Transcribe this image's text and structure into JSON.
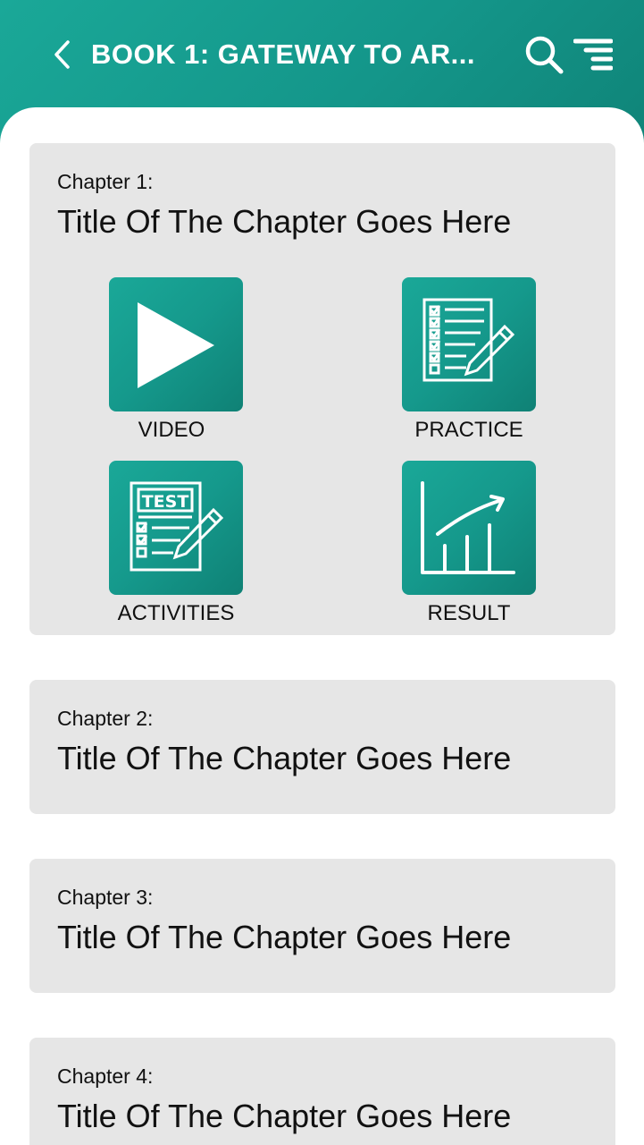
{
  "header": {
    "title": "BOOK 1: GATEWAY TO AR...",
    "back_icon": "chevron-left-icon",
    "search_icon": "search-icon",
    "menu_icon": "menu-icon",
    "colors": {
      "accent": "#14968a",
      "accent_dark": "#0f8377"
    }
  },
  "chapters": [
    {
      "label": "Chapter 1:",
      "title": "Title Of The Chapter Goes Here",
      "expanded": true,
      "actions": [
        {
          "label": "VIDEO",
          "icon": "play-icon"
        },
        {
          "label": "PRACTICE",
          "icon": "checklist-pencil-icon"
        },
        {
          "label": "ACTIVITIES",
          "icon": "test-pencil-icon"
        },
        {
          "label": "RESULT",
          "icon": "growth-chart-icon"
        }
      ]
    },
    {
      "label": "Chapter 2:",
      "title": "Title Of The Chapter Goes Here",
      "expanded": false
    },
    {
      "label": "Chapter 3:",
      "title": "Title Of The Chapter Goes Here",
      "expanded": false
    },
    {
      "label": "Chapter 4:",
      "title": "Title Of The Chapter Goes Here",
      "expanded": false
    }
  ]
}
